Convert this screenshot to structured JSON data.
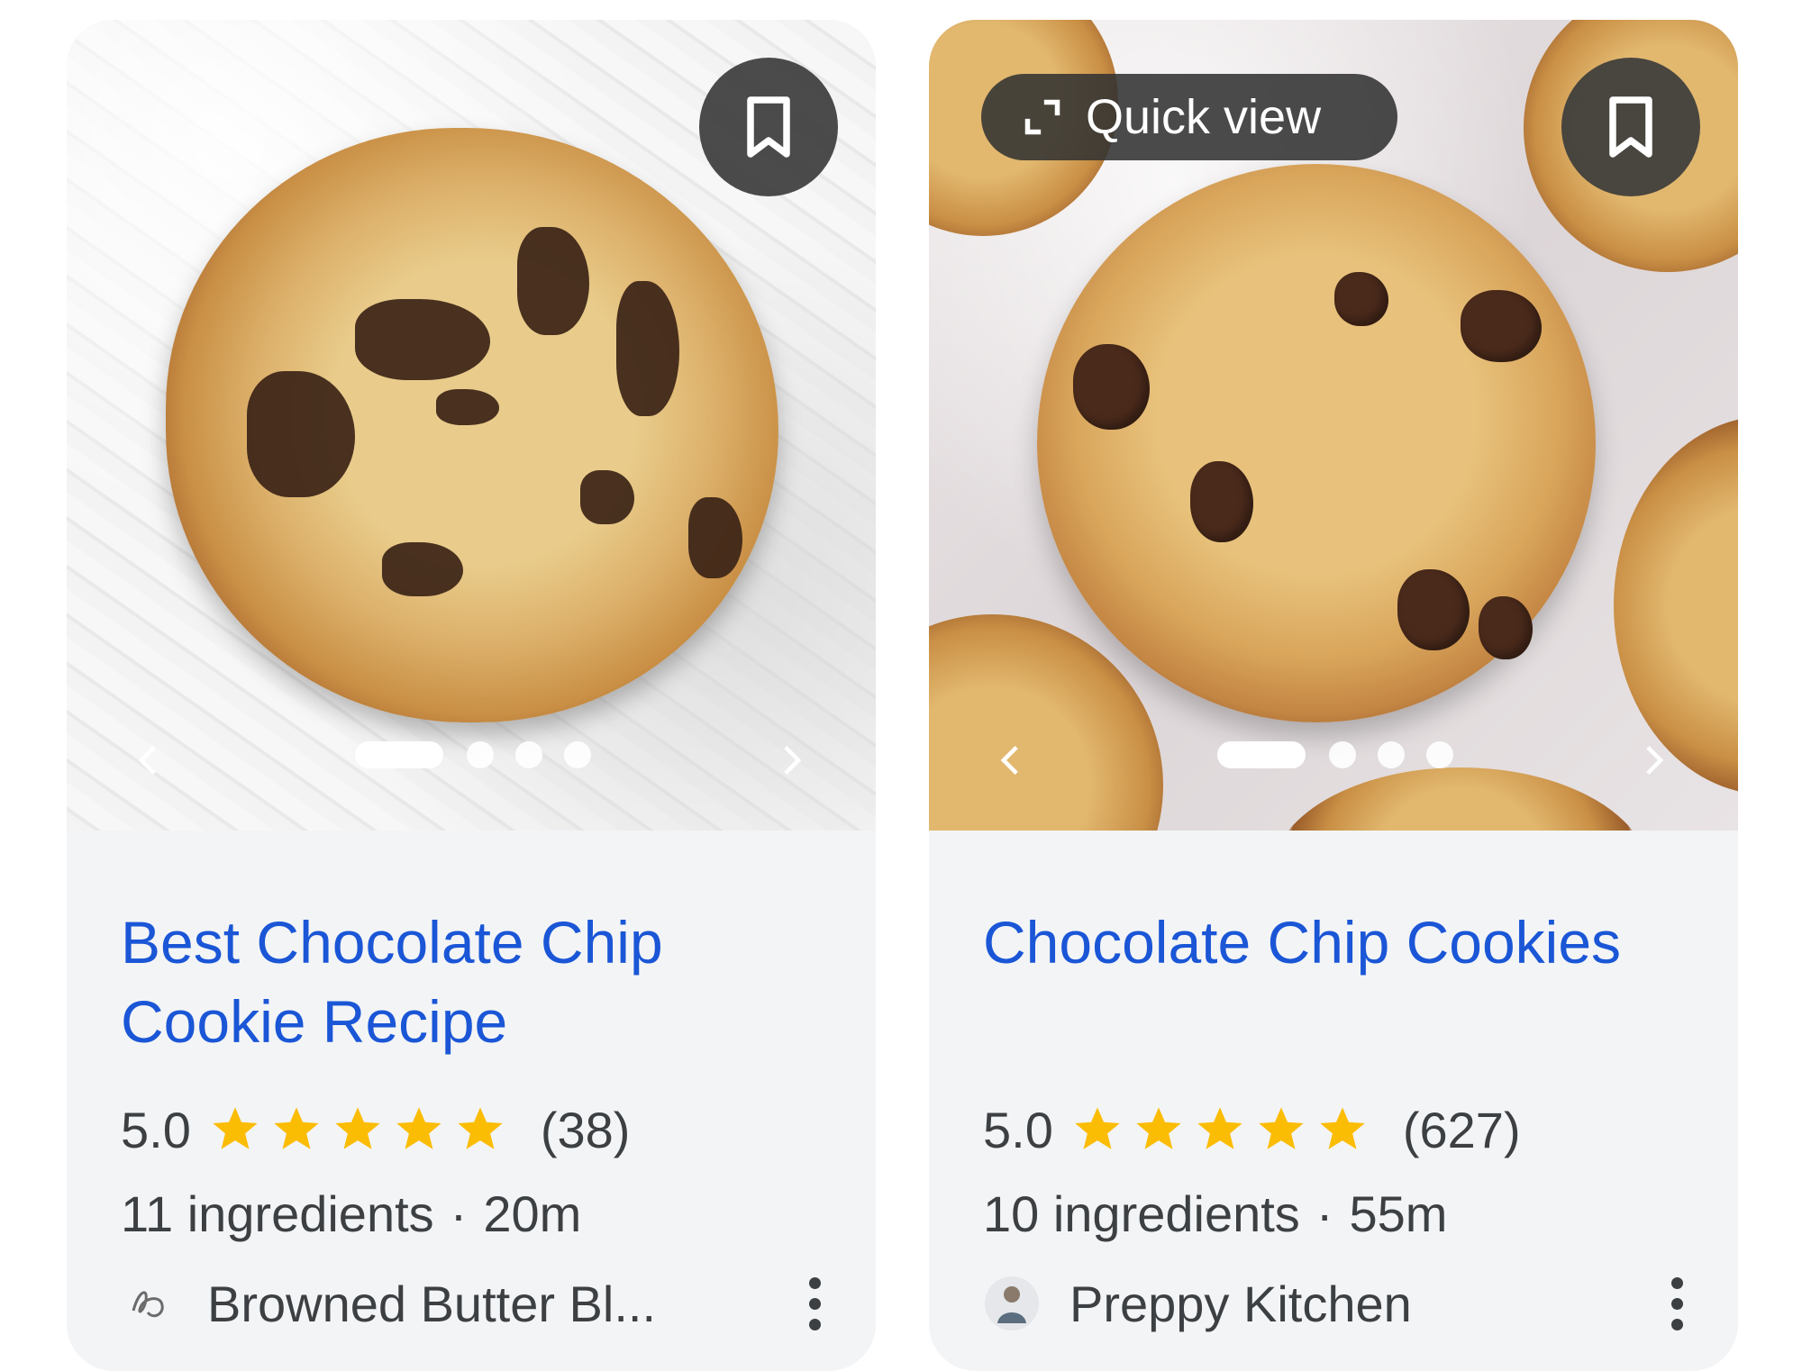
{
  "cards": [
    {
      "title": "Best Chocolate Chip Cookie Recipe",
      "rating": "5.0",
      "star_count": 5,
      "review_count": "(38)",
      "ingredients": "11 ingredients",
      "separator": "·",
      "duration": "20m",
      "source": "Browned Butter Bl...",
      "carousel": {
        "total": 4,
        "active_index": 0
      }
    },
    {
      "quick_view_label": "Quick view",
      "title": "Chocolate Chip Cookies",
      "rating": "5.0",
      "star_count": 5,
      "review_count": "(627)",
      "ingredients": "10 ingredients",
      "separator": "·",
      "duration": "55m",
      "source": "Preppy Kitchen",
      "carousel": {
        "total": 4,
        "active_index": 0
      }
    }
  ],
  "colors": {
    "title_link": "#1a56d6",
    "star": "#fbbc04",
    "card_background": "#f3f4f6",
    "body_text": "#3c4043"
  },
  "icons": {
    "save": "bookmark-icon",
    "quick_view": "expand-icon",
    "prev": "chevron-left-icon",
    "next": "chevron-right-icon",
    "more": "more-vert-icon",
    "rating": "star-icon"
  }
}
